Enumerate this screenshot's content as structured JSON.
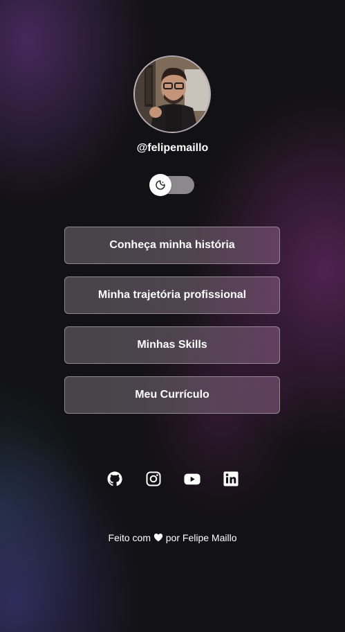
{
  "profile": {
    "handle": "@felipemaillo",
    "avatar_icon": "profile-photo"
  },
  "theme_toggle": {
    "icon": "moon-stars-icon",
    "state": "dark"
  },
  "links": [
    {
      "label": "Conheça minha história"
    },
    {
      "label": "Minha trajetória profissional"
    },
    {
      "label": "Minhas Skills"
    },
    {
      "label": "Meu Currículo"
    }
  ],
  "social": [
    {
      "name": "github",
      "icon": "github-icon"
    },
    {
      "name": "instagram",
      "icon": "instagram-icon"
    },
    {
      "name": "youtube",
      "icon": "youtube-icon"
    },
    {
      "name": "linkedin",
      "icon": "linkedin-icon"
    }
  ],
  "footer": {
    "prefix": "Feito com",
    "heart_icon": "heart-icon",
    "suffix": "por Felipe Maillo"
  },
  "colors": {
    "background": "#121113",
    "accent_purple": "#6e3c96",
    "text": "#ffffff"
  }
}
